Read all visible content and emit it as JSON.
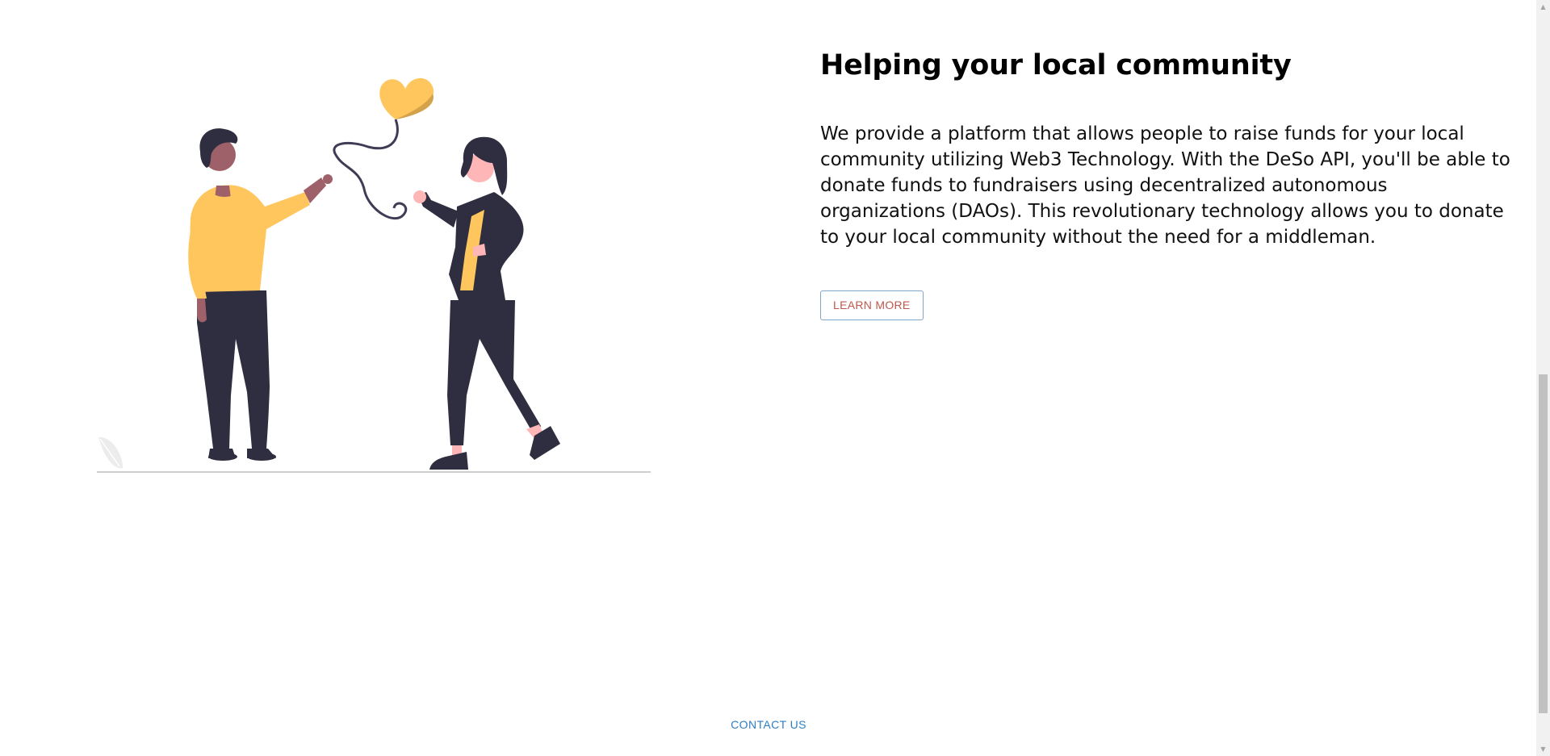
{
  "hero": {
    "title": "Helping your local community",
    "description": "We provide a platform that allows people to raise funds for your local community utilizing Web3 Technology. With the DeSo API, you'll be able to donate funds to fundraisers using decentralized autonomous organizations (DAOs). This revolutionary technology allows you to donate to your local community without the need for a middleman.",
    "learn_more_label": "LEARN MORE",
    "illustration_icon": "people-heart-balloon-illustration"
  },
  "footer": {
    "contact_label": "CONTACT US"
  },
  "colors": {
    "heading": "#000000",
    "button_text": "#c0584d",
    "button_border": "#7fa7cc",
    "link": "#2d7ec4",
    "accent_yellow": "#ffc65e",
    "dark": "#2f2e41"
  }
}
